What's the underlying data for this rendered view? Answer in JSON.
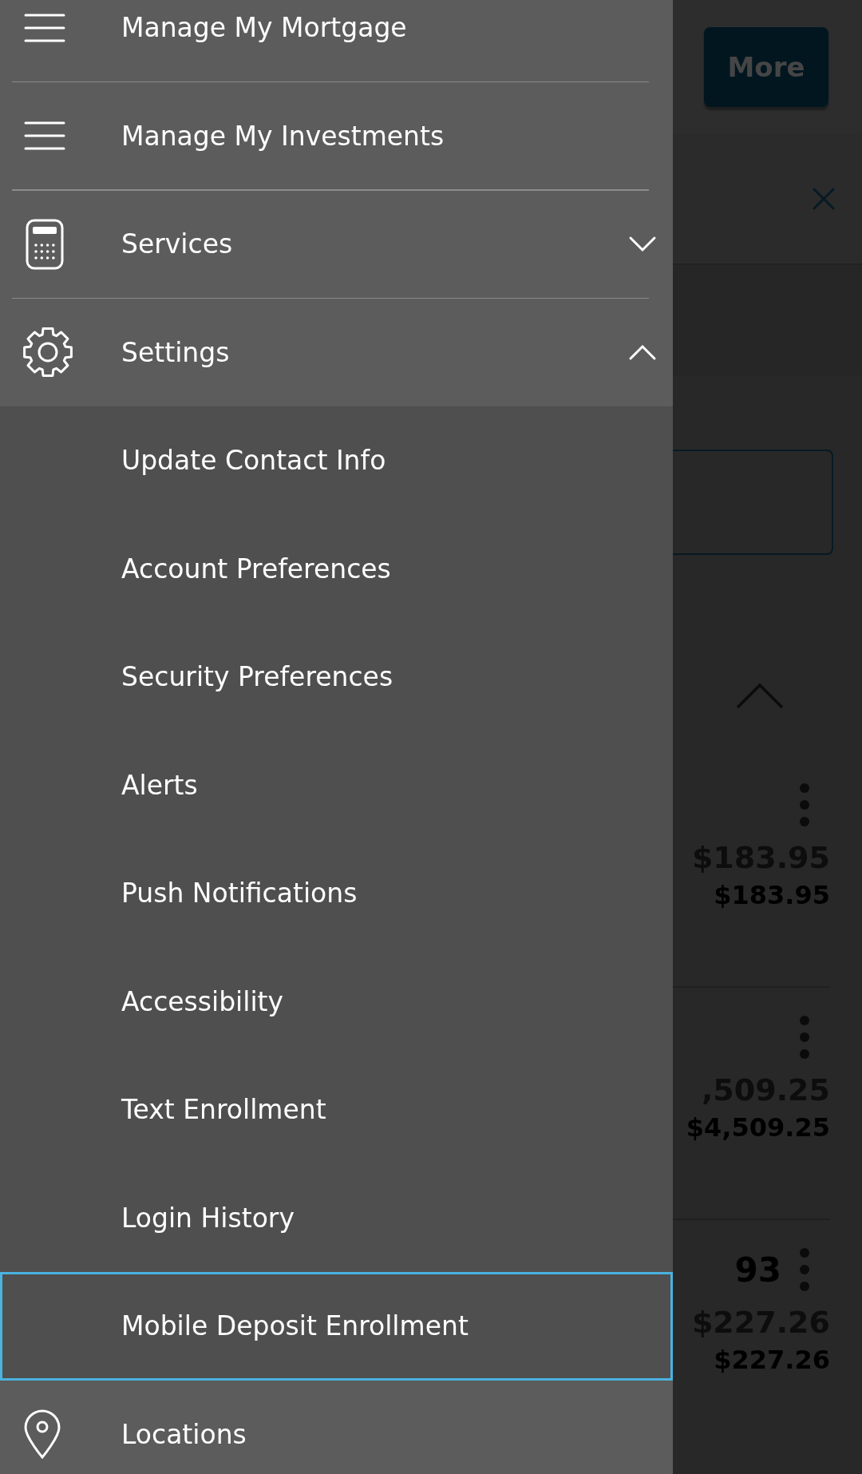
{
  "menu": {
    "items": [
      {
        "kind": "link",
        "label": "Manage My Mortgage"
      },
      {
        "kind": "link",
        "label": "Manage My Investments"
      },
      {
        "kind": "group",
        "label": "Services",
        "expanded": false
      },
      {
        "kind": "group",
        "label": "Settings",
        "expanded": true,
        "children": [
          {
            "label": "Update Contact Info",
            "selected": false
          },
          {
            "label": "Account Preferences",
            "selected": false
          },
          {
            "label": "Security Preferences",
            "selected": false
          },
          {
            "label": "Alerts",
            "selected": false
          },
          {
            "label": "Push Notifications",
            "selected": false
          },
          {
            "label": "Accessibility",
            "selected": false
          },
          {
            "label": "Text Enrollment",
            "selected": false
          },
          {
            "label": "Login History",
            "selected": false
          },
          {
            "label": "Mobile Deposit Enrollment",
            "selected": true
          }
        ]
      },
      {
        "kind": "link",
        "label": "Locations"
      }
    ]
  },
  "background_page": {
    "more_button": "More",
    "accounts": [
      {
        "balance": "$183.95",
        "available": "$183.95"
      },
      {
        "balance": ",509.25",
        "available": "$4,509.25"
      },
      {
        "number": "93",
        "balance": "$227.26",
        "available": "$227.26"
      }
    ]
  }
}
